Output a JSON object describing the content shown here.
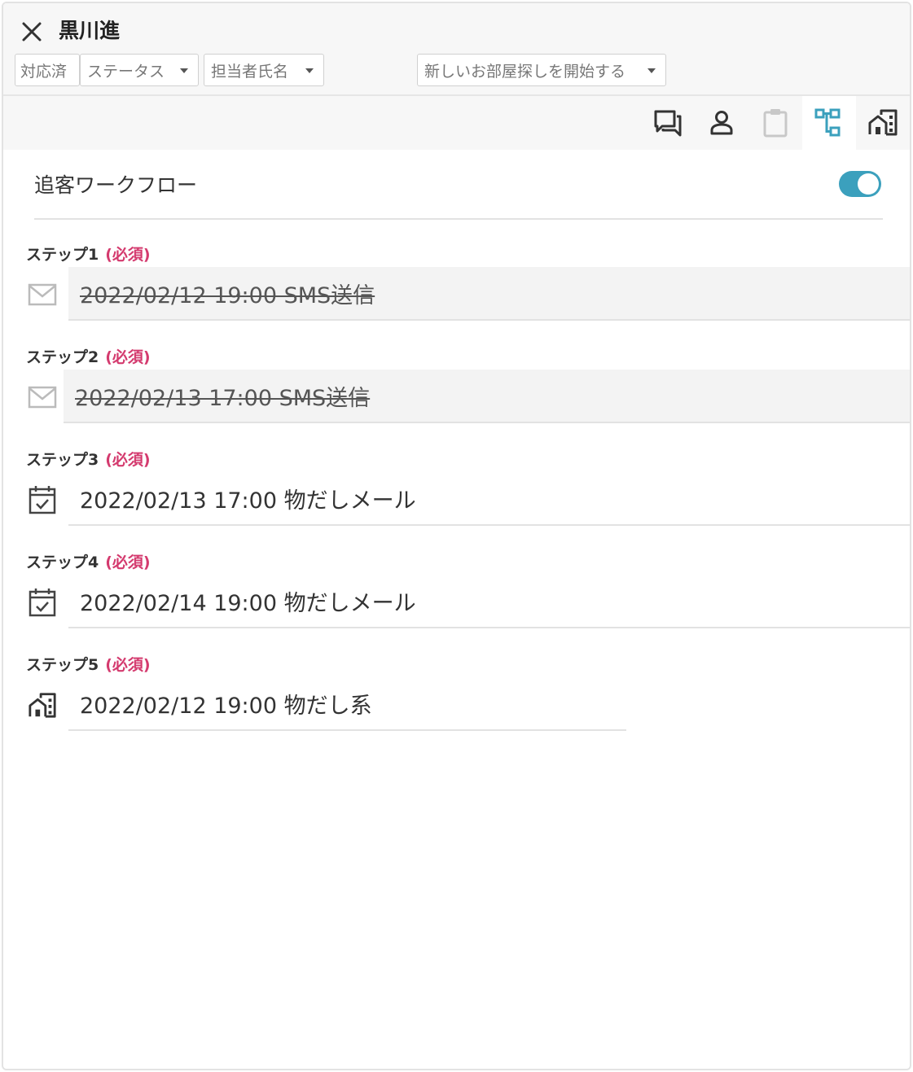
{
  "header": {
    "title": "黒川進",
    "status_fixed": "対応済",
    "status_select": "ステータス",
    "assignee_select": "担当者氏名",
    "flow_select": "新しいお部屋探しを開始する"
  },
  "tabs": [
    {
      "name": "chat-icon",
      "active": false
    },
    {
      "name": "person-icon",
      "active": false
    },
    {
      "name": "clipboard-icon",
      "active": false
    },
    {
      "name": "workflow-icon",
      "active": true
    },
    {
      "name": "building-icon",
      "active": false
    }
  ],
  "workflow": {
    "title": "追客ワークフロー",
    "enabled": true,
    "required_label": "(必須)",
    "steps": [
      {
        "label": "ステップ1",
        "text": "2022/02/12 19:00 SMS送信",
        "icon": "mail-icon",
        "done": true
      },
      {
        "label": "ステップ2",
        "text": "2022/02/13 17:00 SMS送信",
        "icon": "mail-icon",
        "done": true
      },
      {
        "label": "ステップ3",
        "text": "2022/02/13 17:00 物だしメール",
        "icon": "calendar-check-icon",
        "done": false
      },
      {
        "label": "ステップ4",
        "text": "2022/02/14 19:00 物だしメール",
        "icon": "calendar-check-icon",
        "done": false
      },
      {
        "label": "ステップ5",
        "text": "2022/02/12 19:00 物だし系",
        "icon": "building-icon",
        "done": false
      }
    ]
  },
  "colors": {
    "accent": "#3ba0bd",
    "required": "#d43a6e",
    "icon_gray": "#bbbbbb",
    "icon_dark": "#444444"
  }
}
